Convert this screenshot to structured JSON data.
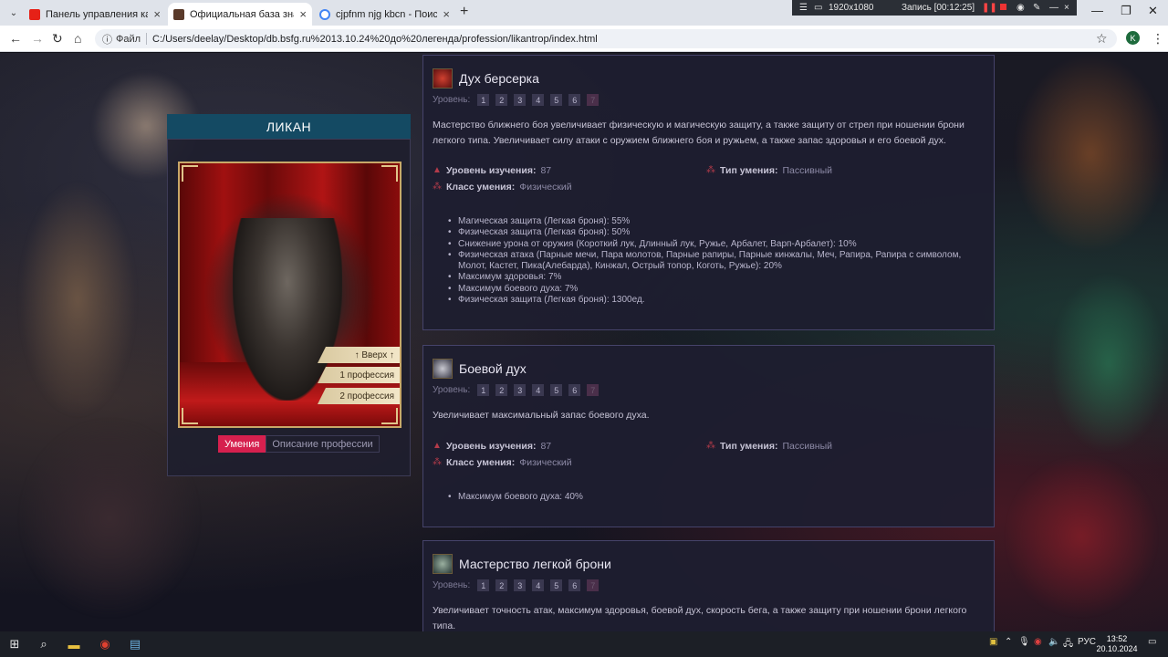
{
  "browser": {
    "tabs": [
      {
        "title": "Панель управления каналом -",
        "icon": "youtube-icon",
        "active": false
      },
      {
        "title": "Официальная база знаний Ва",
        "icon": "site-icon",
        "active": true
      },
      {
        "title": "cjpfnm njg kbcn - Поиск в Goo",
        "icon": "google-icon",
        "active": false
      }
    ],
    "new_tab": "+",
    "file_label": "Файл",
    "url": "C:/Users/deelay/Desktop/db.bsfg.ru%2013.10.24%20до%20легенда/profession/likantrop/index.html",
    "profile_letter": "K"
  },
  "recorder": {
    "resolution": "1920x1080",
    "status": "Запись [00:12:25]"
  },
  "profession": {
    "title": "ЛИКАН",
    "buttons": [
      "↑ Вверх ↑",
      "1 профессия",
      "2 профессия"
    ],
    "tabs": [
      "Умения",
      "Описание профессии"
    ]
  },
  "labels": {
    "level": "Уровень:",
    "study_level": "Уровень изучения:",
    "skill_type": "Тип умения:",
    "skill_class": "Класс умения:"
  },
  "skills": [
    {
      "name": "Дух берсерка",
      "levels": [
        "1",
        "2",
        "3",
        "4",
        "5",
        "6",
        "7"
      ],
      "description": "Мастерство ближнего боя увеличивает физическую и магическую защиту, а также защиту от стрел при ношении брони легкого типа. Увеличивает силу атаки с оружием ближнего боя и ружьем, а также запас здоровья и его боевой дух.",
      "study_level": "87",
      "type": "Пассивный",
      "class": "Физический",
      "stats": [
        "Магическая защита (Легкая броня): 55%",
        "Физическая защита (Легкая броня): 50%",
        "Снижение урона от оружия (Короткий лук, Длинный лук, Ружье, Арбалет, Варп-Арбалет): 10%",
        "Физическая атака (Парные мечи, Пара молотов, Парные рапиры, Парные кинжалы, Меч, Рапира, Рапира с символом, Молот, Кастет, Пика(Алебарда), Кинжал, Острый топор, Коготь, Ружье): 20%",
        "Максимум здоровья: 7%",
        "Максимум боевого духа: 7%",
        "Физическая защита (Легкая броня): 1300ед."
      ]
    },
    {
      "name": "Боевой дух",
      "levels": [
        "1",
        "2",
        "3",
        "4",
        "5",
        "6",
        "7"
      ],
      "description": "Увеличивает максимальный запас боевого духа.",
      "study_level": "87",
      "type": "Пассивный",
      "class": "Физический",
      "stats": [
        "Максимум боевого духа: 40%"
      ]
    },
    {
      "name": "Мастерство легкой брони",
      "levels": [
        "1",
        "2",
        "3",
        "4",
        "5",
        "6",
        "7"
      ],
      "description": "Увеличивает точность атак, максимум здоровья, боевой дух, скорость бега, а также защиту при ношении брони легкого типа."
    }
  ],
  "taskbar": {
    "language": "РУС",
    "time": "13:52",
    "date": "20.10.2024"
  },
  "colors": {
    "accent_pink": "#d6204e",
    "title_bar": "#144a63",
    "panel_bg": "#1e1e30",
    "panel_border": "#45436a"
  }
}
